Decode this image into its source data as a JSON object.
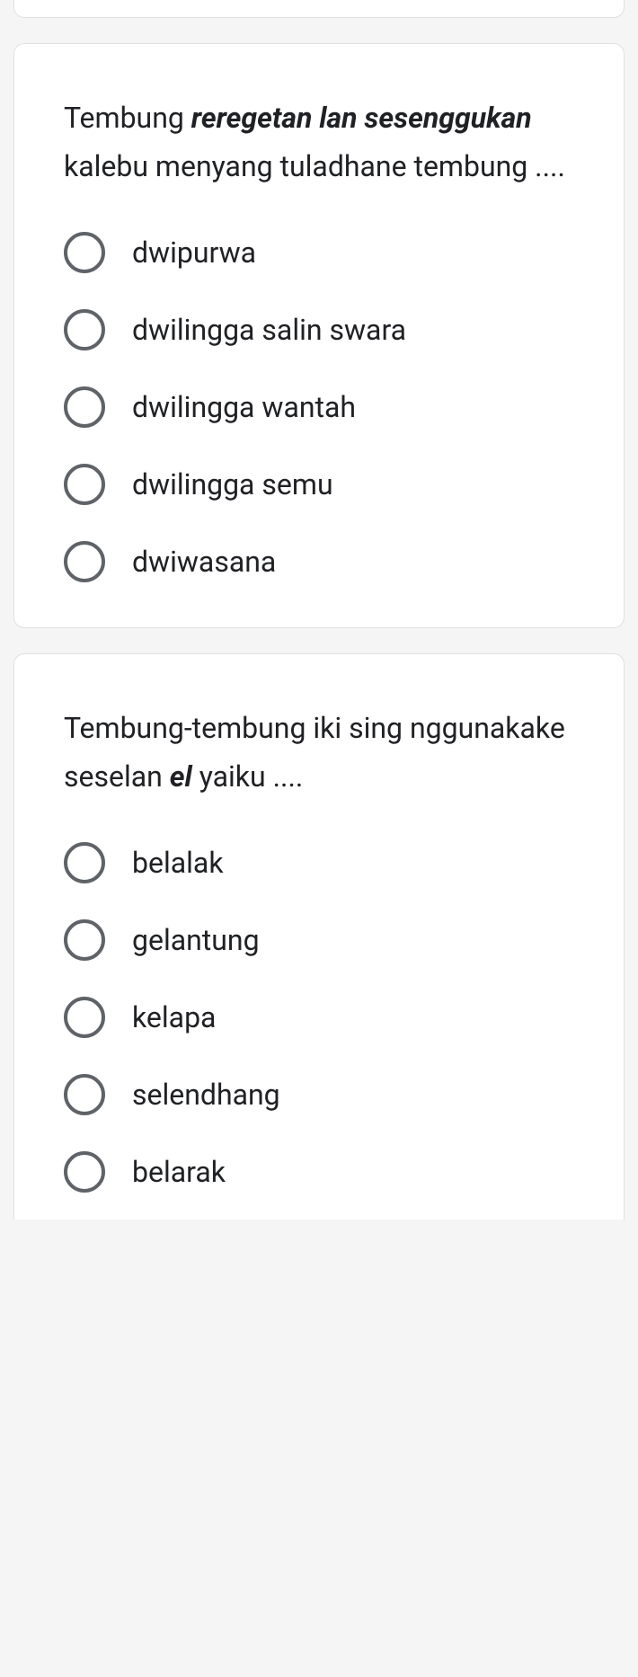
{
  "questions": [
    {
      "prompt_prefix": "Tembung ",
      "prompt_bold": "reregetan lan sesenggukan",
      "prompt_suffix_line1": "",
      "prompt_suffix_line2": "kalebu menyang tuladhane tembung ....",
      "options": [
        {
          "label": "dwipurwa"
        },
        {
          "label": "dwilingga salin swara"
        },
        {
          "label": "dwilingga wantah"
        },
        {
          "label": "dwilingga semu"
        },
        {
          "label": "dwiwasana"
        }
      ]
    },
    {
      "prompt_prefix": "Tembung-tembung iki sing nggunakake seselan ",
      "prompt_bold": "el",
      "prompt_suffix": " yaiku ....",
      "options": [
        {
          "label": "belalak"
        },
        {
          "label": "gelantung"
        },
        {
          "label": "kelapa"
        },
        {
          "label": "selendhang"
        },
        {
          "label": "belarak"
        }
      ]
    }
  ]
}
